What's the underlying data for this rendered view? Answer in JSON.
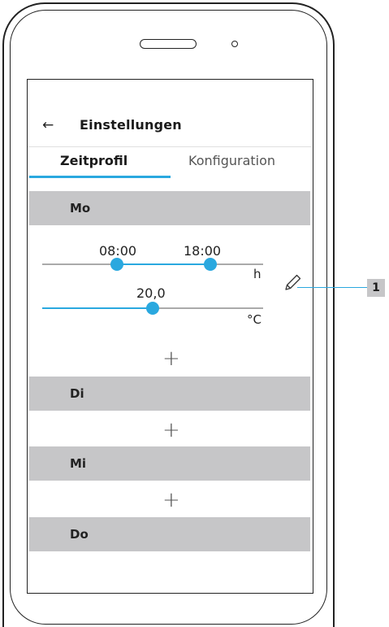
{
  "header": {
    "back_icon": "←",
    "title": "Einstellungen"
  },
  "tabs": [
    {
      "label": "Zeitprofil",
      "active": true
    },
    {
      "label": "Konfiguration",
      "active": false
    }
  ],
  "days": [
    {
      "label": "Mo",
      "expanded": true
    },
    {
      "label": "Di",
      "expanded": false
    },
    {
      "label": "Mi",
      "expanded": false
    },
    {
      "label": "Do",
      "expanded": false
    }
  ],
  "time_slider": {
    "start": "08:00",
    "end": "18:00",
    "unit": "h"
  },
  "temp_slider": {
    "value": "20,0",
    "unit": "°C"
  },
  "plus_glyph": "+",
  "callout": {
    "number": "1"
  },
  "colors": {
    "accent": "#2aa8df",
    "day_bar": "#c6c6c8"
  },
  "icons": {
    "edit": "pencil-icon",
    "back": "arrow-left-icon",
    "add": "plus-icon"
  }
}
